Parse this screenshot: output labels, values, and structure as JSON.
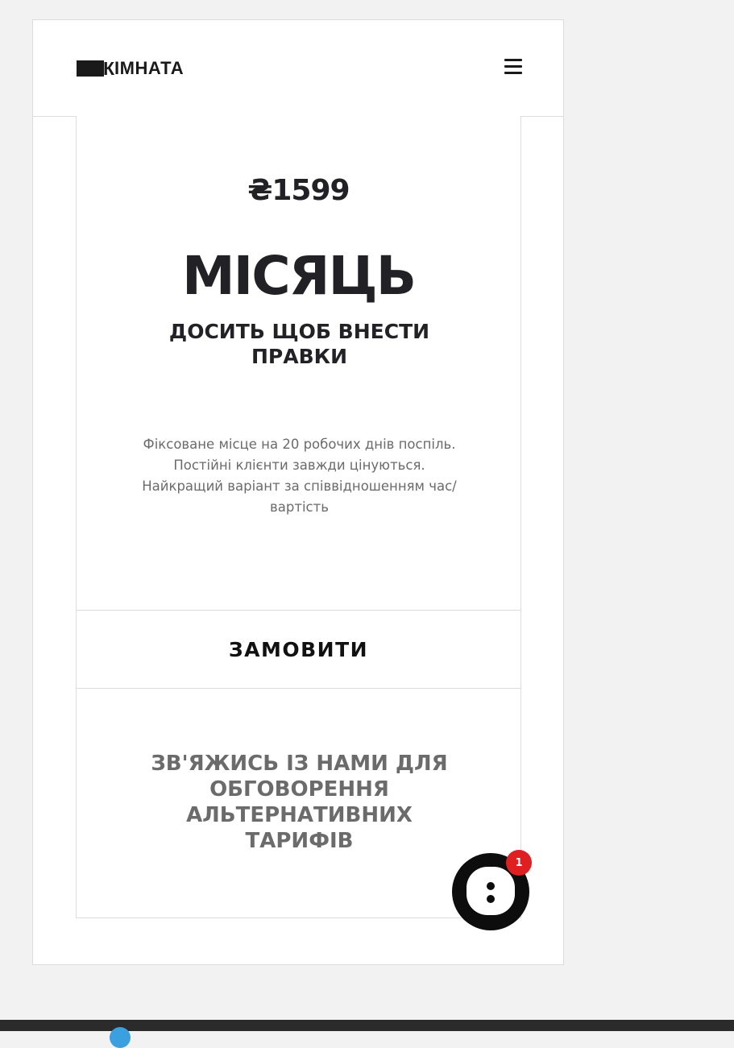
{
  "header": {
    "logo_text": "ІМНАТА",
    "logo_letter": "К",
    "menu_icon": "hamburger-menu-icon"
  },
  "plan": {
    "price": "₴1599",
    "title": "МІСЯЦЬ",
    "subtitle": "ДОСИТЬ ЩОБ ВНЕСТИ ПРАВКИ",
    "description": [
      "Фіксоване місце на 20 робочих днів поспіль.",
      "Постійні клієнти завжди цінуються.",
      "Найкращий варіант за співвідношенням час/",
      "вартість"
    ],
    "order_label": "ЗАМОВИТИ"
  },
  "contact": {
    "lines": [
      "ЗВ'ЯЖИСЬ ІЗ НАМИ ДЛЯ",
      "ОБГОВОРЕННЯ",
      "АЛЬТЕРНАТИВНИХ",
      "ТАРИФІВ"
    ]
  },
  "chat": {
    "icon": "chat-bubble-icon",
    "badge_count": "1",
    "badge_color": "#e02020"
  },
  "colors": {
    "text_dark": "#222226",
    "text_muted": "#6b6b6b",
    "border": "#dcdcdc"
  }
}
